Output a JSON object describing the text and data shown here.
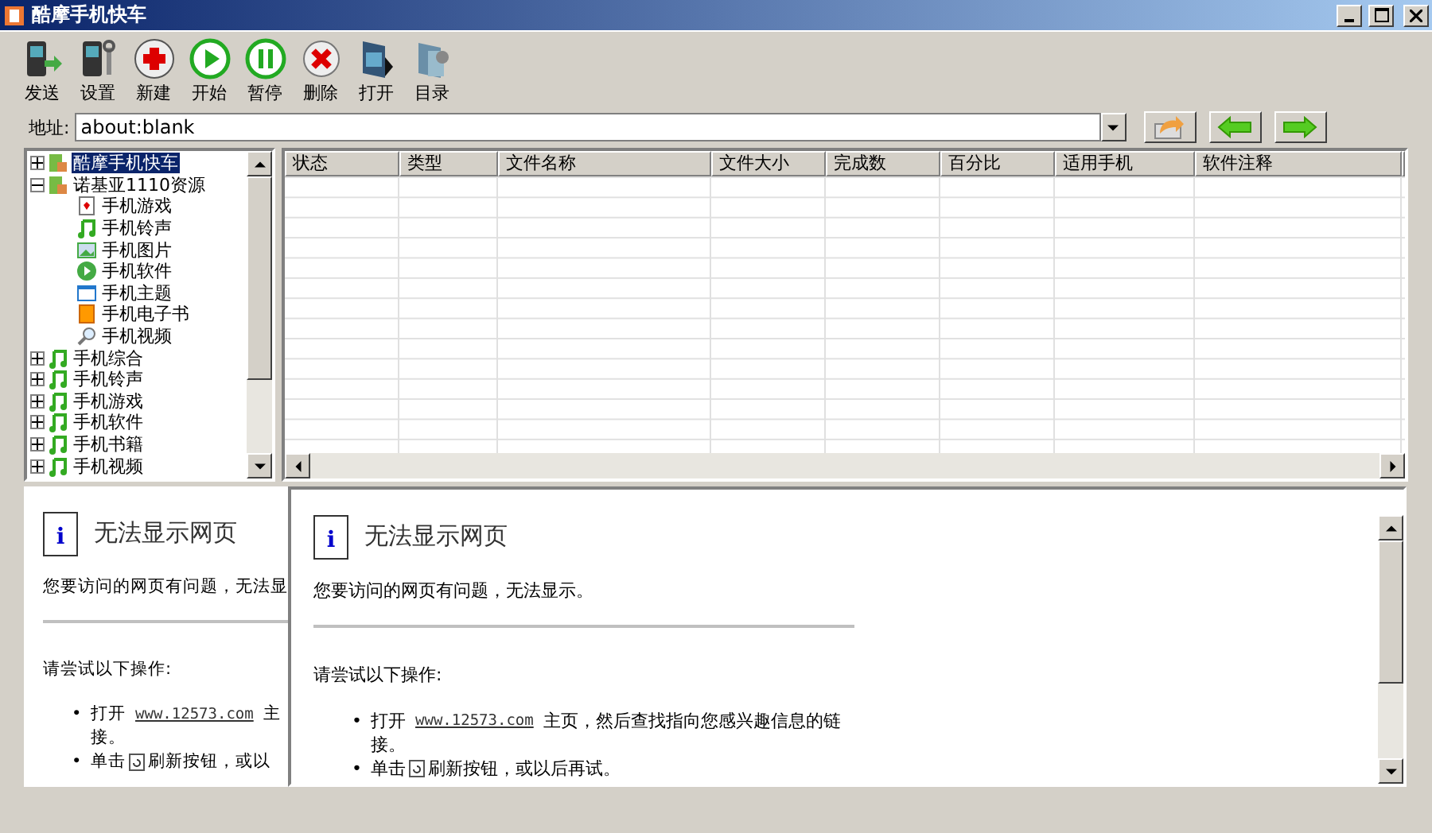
{
  "window": {
    "title": "酷摩手机快车"
  },
  "toolbar": [
    {
      "label": "发送",
      "kind": "send"
    },
    {
      "label": "设置",
      "kind": "settings"
    },
    {
      "label": "新建",
      "kind": "new"
    },
    {
      "label": "开始",
      "kind": "start"
    },
    {
      "label": "暂停",
      "kind": "pause"
    },
    {
      "label": "删除",
      "kind": "delete"
    },
    {
      "label": "打开",
      "kind": "open"
    },
    {
      "label": "目录",
      "kind": "folder"
    }
  ],
  "address": {
    "label": "地址:",
    "value": "about:blank"
  },
  "tree": [
    {
      "label": "酷摩手机快车",
      "kind": "phone",
      "selected": true,
      "expanded": false
    },
    {
      "label": "诺基亚1110资源",
      "kind": "phone",
      "selected": false,
      "expanded": true,
      "children": [
        {
          "label": "手机游戏",
          "kind": "game",
          "selected": false
        },
        {
          "label": "手机铃声",
          "kind": "music",
          "selected": false
        },
        {
          "label": "手机图片",
          "kind": "image",
          "selected": false
        },
        {
          "label": "手机软件",
          "kind": "play",
          "selected": false
        },
        {
          "label": "手机主题",
          "kind": "theme",
          "selected": false
        },
        {
          "label": "手机电子书",
          "kind": "book",
          "selected": false
        },
        {
          "label": "手机视频",
          "kind": "search",
          "selected": false
        }
      ]
    },
    {
      "label": "手机综合",
      "kind": "music",
      "selected": false,
      "expanded": false
    },
    {
      "label": "手机铃声",
      "kind": "music",
      "selected": false,
      "expanded": false
    },
    {
      "label": "手机游戏",
      "kind": "music",
      "selected": false,
      "expanded": false
    },
    {
      "label": "手机软件",
      "kind": "music",
      "selected": false,
      "expanded": false
    },
    {
      "label": "手机书籍",
      "kind": "music",
      "selected": false,
      "expanded": false
    },
    {
      "label": "手机视频",
      "kind": "music",
      "selected": false,
      "expanded": false
    }
  ],
  "table": {
    "columns": [
      "状态",
      "类型",
      "文件名称",
      "文件大小",
      "完成数",
      "百分比",
      "适用手机",
      "软件注释"
    ]
  },
  "pages": [
    {
      "icon_text": "i",
      "title": "无法显示网页",
      "message": "您要访问的网页有问题，无法显",
      "prompt": "请尝试以下操作:",
      "bullets": [
        {
          "kind": "link",
          "marker": "•",
          "before": "打开",
          "link": "www.12573.com",
          "after": "主",
          "wrap": "接。"
        },
        {
          "kind": "refresh",
          "marker": "•",
          "before": "单击",
          "after": "刷新按钮，或以"
        }
      ]
    },
    {
      "icon_text": "i",
      "title": "无法显示网页",
      "message": "您要访问的网页有问题，无法显示。",
      "prompt": "请尝试以下操作:",
      "bullets": [
        {
          "kind": "link",
          "marker": "•",
          "before": "打开",
          "link": "www.12573.com",
          "after": "主页，然后查找指向您感兴趣信息的链",
          "wrap": "接。"
        },
        {
          "kind": "refresh",
          "marker": "•",
          "before": "单击",
          "after": "刷新按钮，或以后再试。"
        }
      ]
    }
  ]
}
